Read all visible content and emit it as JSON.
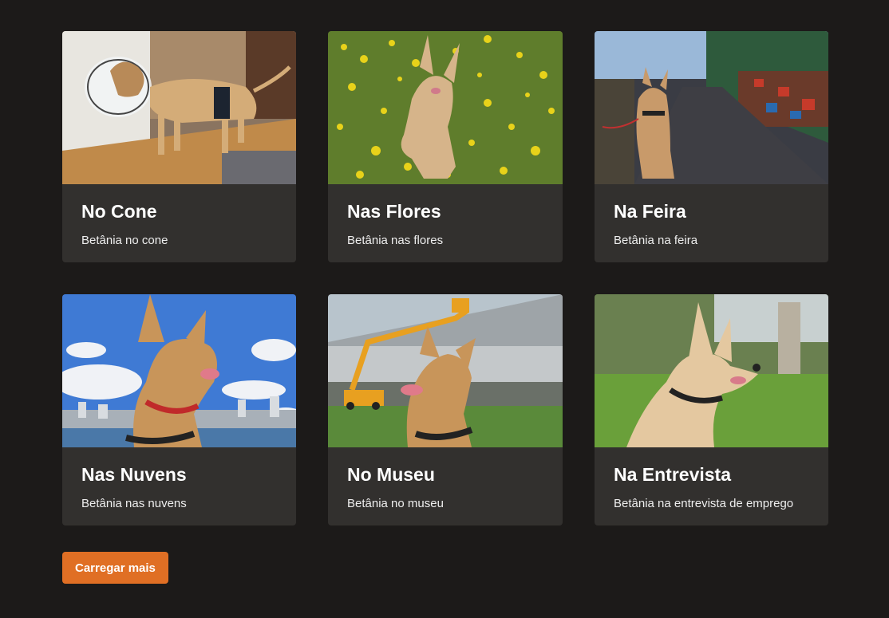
{
  "gallery": {
    "cards": [
      {
        "title": "No Cone",
        "description": "Betânia no cone",
        "photo": "dog-with-cone-photo"
      },
      {
        "title": "Nas Flores",
        "description": "Betânia nas flores",
        "photo": "dog-in-flowers-photo"
      },
      {
        "title": "Na Feira",
        "description": "Betânia na feira",
        "photo": "dog-at-market-photo"
      },
      {
        "title": "Nas Nuvens",
        "description": "Betânia nas nuvens",
        "photo": "dog-in-clouds-photo"
      },
      {
        "title": "No Museu",
        "description": "Betânia no museu",
        "photo": "dog-at-museum-photo"
      },
      {
        "title": "Na Entrevista",
        "description": "Betânia na entrevista de emprego",
        "photo": "dog-at-interview-photo"
      }
    ]
  },
  "load_more_label": "Carregar mais",
  "colors": {
    "background": "#1c1a19",
    "card": "#32302e",
    "accent": "#e06f24"
  }
}
